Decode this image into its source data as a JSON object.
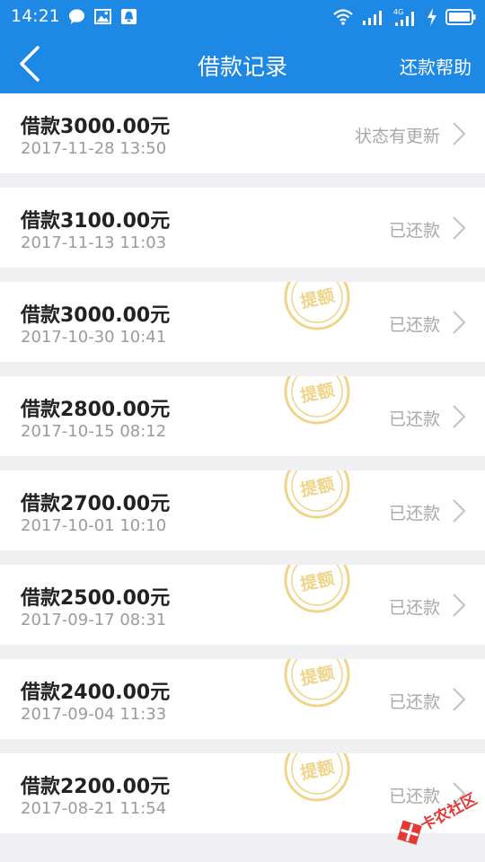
{
  "statusbar": {
    "time": "14:21"
  },
  "header": {
    "back": "back",
    "title": "借款记录",
    "help": "还款帮助"
  },
  "stamp_text": "提额",
  "records": [
    {
      "amount": "借款3000.00元",
      "date": "2017-11-28 13:50",
      "status": "状态有更新",
      "stamp": false
    },
    {
      "amount": "借款3100.00元",
      "date": "2017-11-13 11:03",
      "status": "已还款",
      "stamp": false
    },
    {
      "amount": "借款3000.00元",
      "date": "2017-10-30 10:41",
      "status": "已还款",
      "stamp": true
    },
    {
      "amount": "借款2800.00元",
      "date": "2017-10-15 08:12",
      "status": "已还款",
      "stamp": true
    },
    {
      "amount": "借款2700.00元",
      "date": "2017-10-01 10:10",
      "status": "已还款",
      "stamp": true
    },
    {
      "amount": "借款2500.00元",
      "date": "2017-09-17 08:31",
      "status": "已还款",
      "stamp": true
    },
    {
      "amount": "借款2400.00元",
      "date": "2017-09-04 11:33",
      "status": "已还款",
      "stamp": true
    },
    {
      "amount": "借款2200.00元",
      "date": "2017-08-21 11:54",
      "status": "已还款",
      "stamp": true
    }
  ],
  "watermark": "卡农社区",
  "colors": {
    "primary": "#1e88e5",
    "stamp": "#f0d48a"
  }
}
